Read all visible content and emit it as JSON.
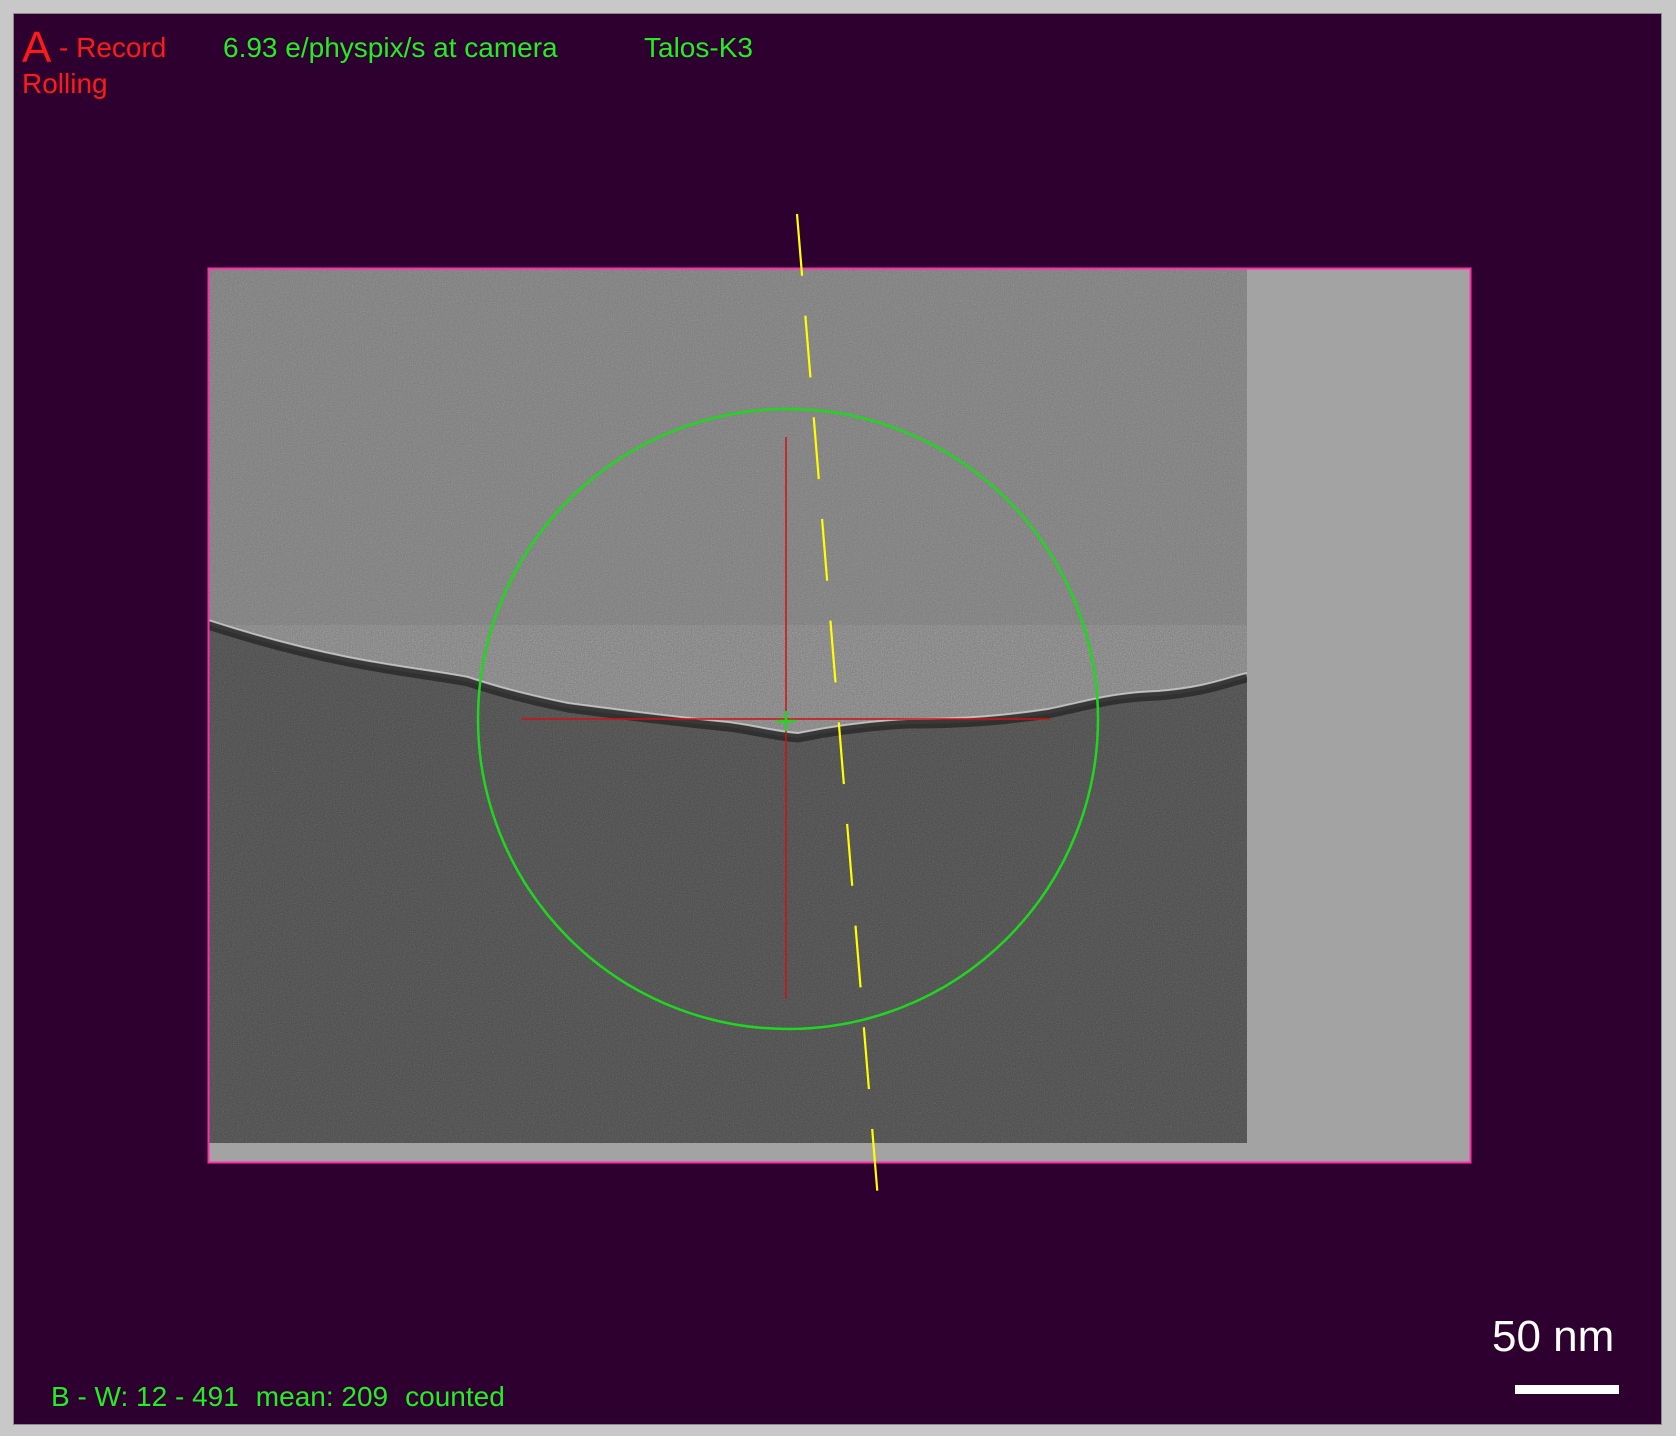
{
  "status": {
    "set_letter": "A",
    "set_rest": "- Record",
    "mode": "Rolling",
    "dose_rate": "6.93 e/physpix/s at camera",
    "camera": "Talos-K3"
  },
  "stats": {
    "bw": "B - W: 12 - 491",
    "mean": "mean: 209",
    "mode": "counted"
  },
  "scale_bar": {
    "label": "50 nm"
  },
  "colors": {
    "background": "#2e0030",
    "frame_border": "#ff2fa8",
    "padding_gray": "#a3a3a3",
    "circle": "#1ed81e",
    "tilt_axis": "#ffff00",
    "crosshair": "#d01010",
    "status_red": "#ff1a1a",
    "status_green": "#22ee22",
    "scale_bar": "#ffffff"
  }
}
